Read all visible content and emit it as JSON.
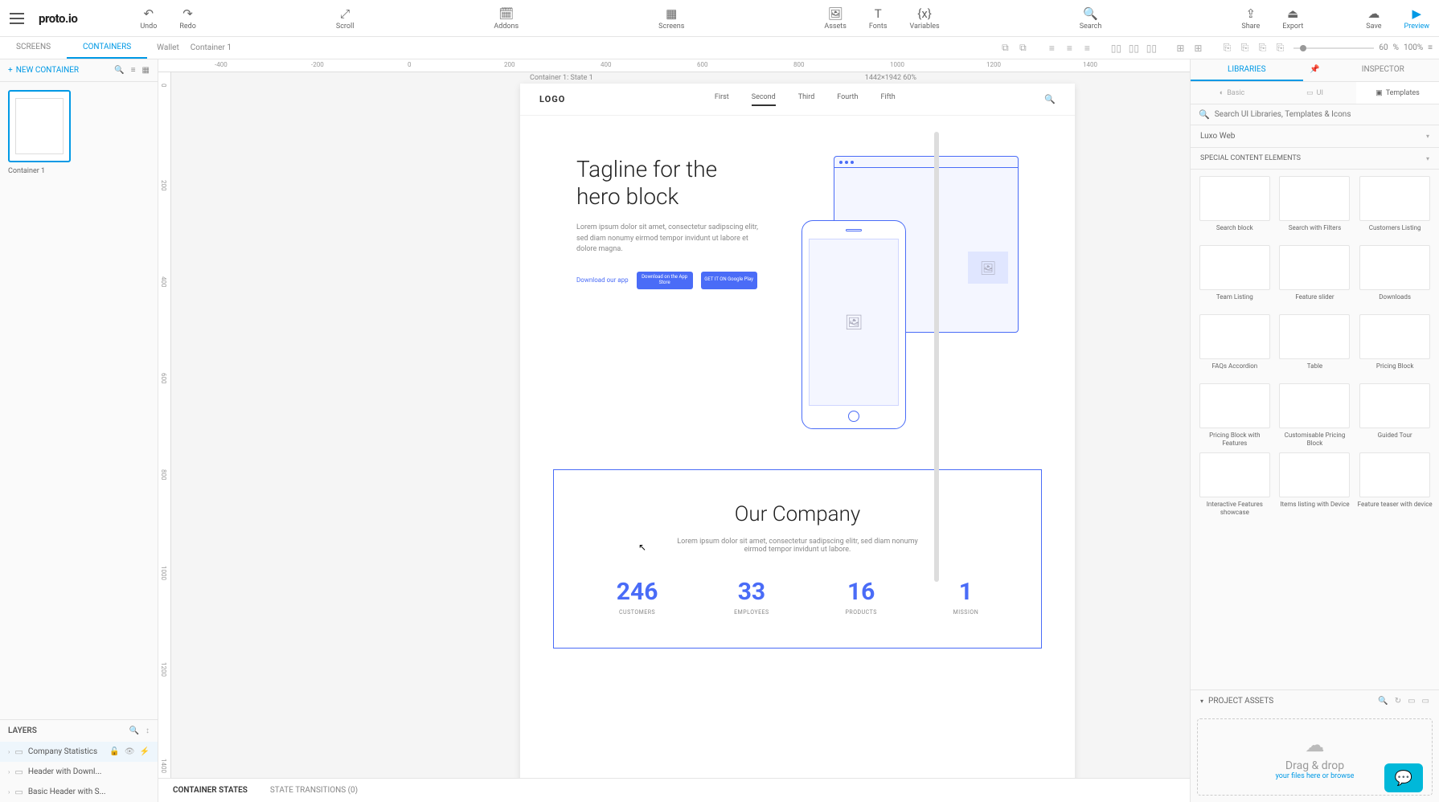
{
  "app": {
    "logo": "proto.io"
  },
  "toolbar": {
    "undo": "Undo",
    "redo": "Redo",
    "scroll": "Scroll",
    "addons": "Addons",
    "screens": "Screens",
    "assets": "Assets",
    "fonts": "Fonts",
    "variables": "Variables",
    "search": "Search",
    "share": "Share",
    "export": "Export",
    "save": "Save",
    "preview": "Preview"
  },
  "subbar": {
    "tab_screens": "SCREENS",
    "tab_containers": "CONTAINERS",
    "crumb1": "Wallet",
    "crumb2": "Container 1",
    "zoom_value": "60",
    "zoom_unit": "%",
    "zoom_100": "100%"
  },
  "left": {
    "new_container": "NEW CONTAINER",
    "thumb_label": "Container 1",
    "layers_title": "LAYERS",
    "layers": [
      "Company Statistics",
      "Header with Downl...",
      "Basic Header with S..."
    ]
  },
  "canvas": {
    "label": "Container 1: State 1",
    "meta": "1442×1942  60%",
    "ruler_h": [
      "-400",
      "-200",
      "0",
      "200",
      "400",
      "600",
      "800",
      "1000",
      "1200",
      "1400"
    ],
    "ruler_v": [
      "0",
      "200",
      "400",
      "600",
      "800",
      "1000",
      "1200",
      "1400"
    ]
  },
  "artboard": {
    "logo": "LOGO",
    "nav": [
      "First",
      "Second",
      "Third",
      "Fourth",
      "Fifth"
    ],
    "nav_active": 1,
    "hero_title": "Tagline for the hero block",
    "hero_body": "Lorem ipsum dolor sit amet, consectetur sadipscing elitr, sed diam nonumy eirmod tempor invidunt ut labore et dolore magna.",
    "download_link": "Download our app",
    "appstore": "Download on the App Store",
    "playstore": "GET IT ON Google Play",
    "company_title": "Our Company",
    "company_body": "Lorem ipsum dolor sit amet, consectetur sadipscing elitr, sed diam nonumy eirmod tempor invidunt ut labore.",
    "stats": [
      {
        "num": "246",
        "lbl": "CUSTOMERS"
      },
      {
        "num": "33",
        "lbl": "EMPLOYEES"
      },
      {
        "num": "16",
        "lbl": "PRODUCTS"
      },
      {
        "num": "1",
        "lbl": "MISSION"
      }
    ]
  },
  "right": {
    "tab_libraries": "LIBRARIES",
    "tab_inspector": "INSPECTOR",
    "sub_basic": "Basic",
    "sub_ui": "UI",
    "sub_templates": "Templates",
    "search_placeholder": "Search UI Libraries, Templates & Icons",
    "section_luxo": "Luxo Web",
    "section_special": "SPECIAL CONTENT ELEMENTS",
    "items": [
      "Search block",
      "Search with Filters",
      "Customers Listing",
      "Team Listing",
      "Feature slider",
      "Downloads",
      "FAQs Accordion",
      "Table",
      "Pricing Block",
      "Pricing Block with Features",
      "Customisable Pricing Block",
      "Guided Tour",
      "Interactive Features showcase",
      "Items listing with Device",
      "Feature teaser with device"
    ],
    "assets_title": "PROJECT ASSETS",
    "drop_title": "Drag & drop",
    "drop_sub_prefix": "your files here or ",
    "drop_sub_link": "browse"
  },
  "bottom": {
    "states": "CONTAINER STATES",
    "transitions": "STATE TRANSITIONS (0)"
  }
}
